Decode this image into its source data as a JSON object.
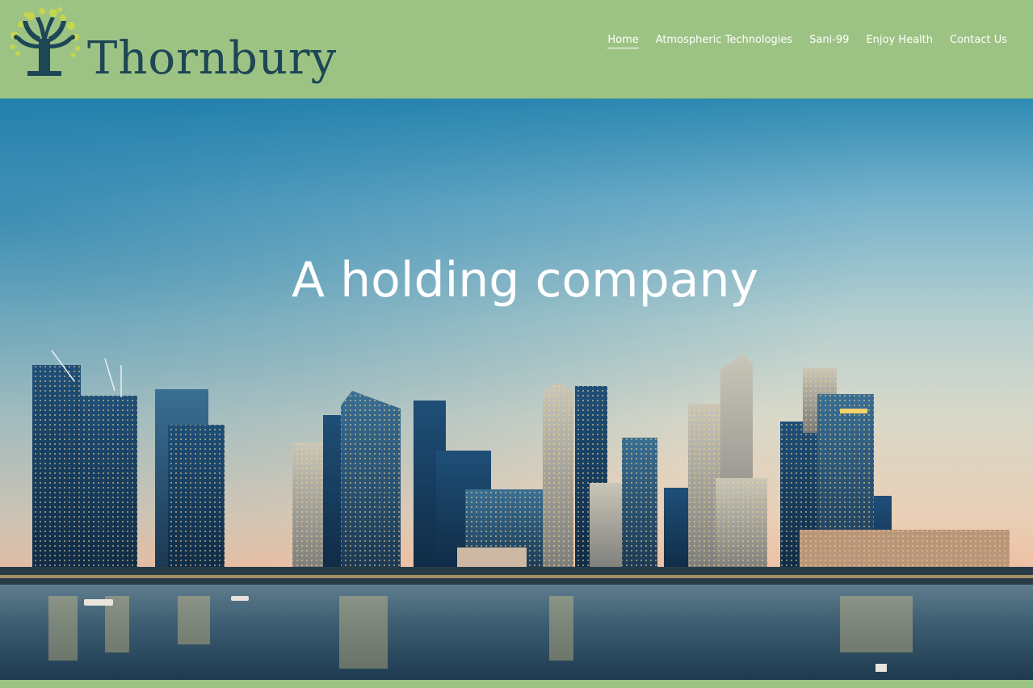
{
  "brand": {
    "name": "Thornbury",
    "logo_icon": "tree-icon",
    "colors": {
      "header_bg": "#9dc384",
      "wordmark": "#1d4656",
      "leaf": "#c9d94a"
    }
  },
  "nav": {
    "items": [
      {
        "label": "Home",
        "active": true
      },
      {
        "label": "Atmospheric Technologies",
        "active": false
      },
      {
        "label": "Sani-99",
        "active": false
      },
      {
        "label": "Enjoy Health",
        "active": false
      },
      {
        "label": "Contact Us",
        "active": false
      }
    ]
  },
  "hero": {
    "title": "A holding company",
    "image": "city-skyline-at-dusk"
  }
}
